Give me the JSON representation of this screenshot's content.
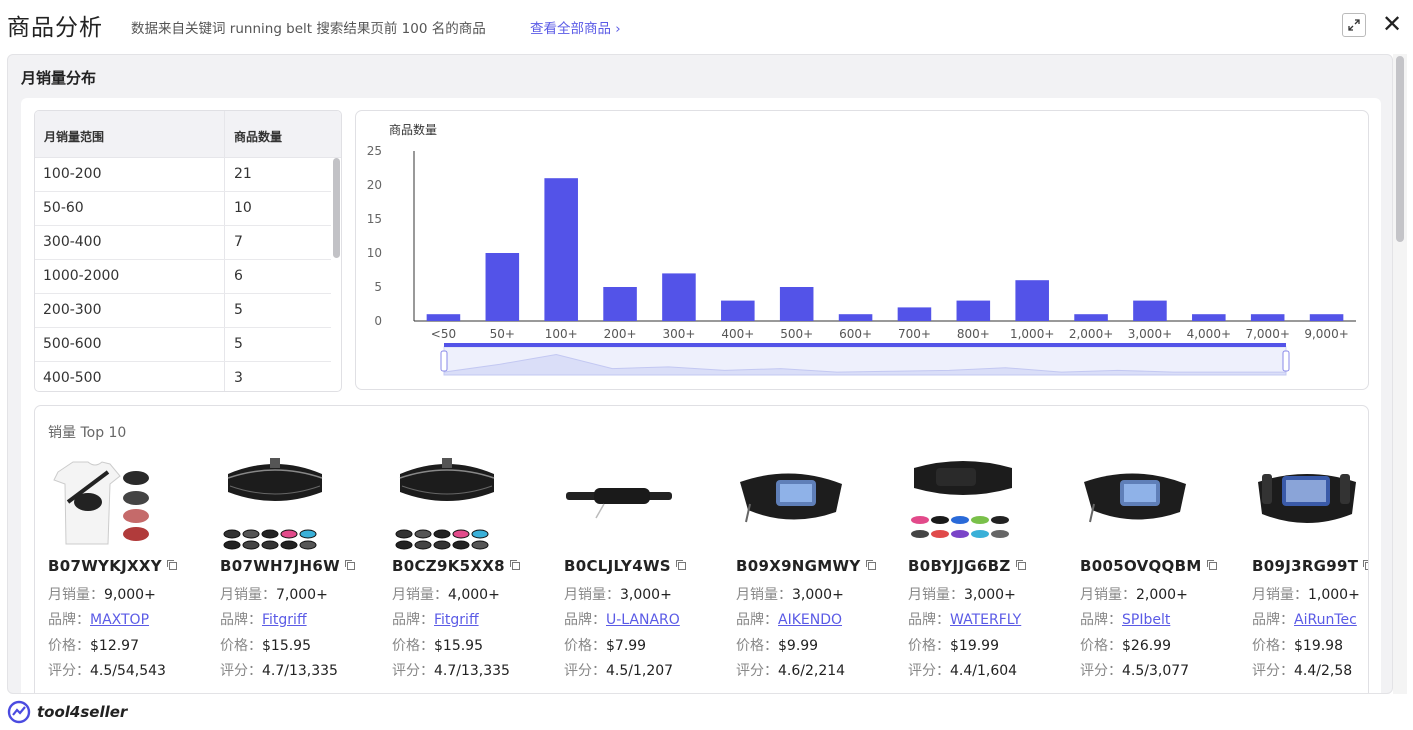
{
  "header": {
    "title": "商品分析",
    "subtitle": "数据来自关键词 running belt 搜索结果页前 100 名的商品",
    "view_all": "查看全部商品 ›",
    "expand_icon": "expand-icon",
    "close_icon": "close-icon",
    "close_glyph": "✕"
  },
  "section": {
    "title": "月销量分布"
  },
  "table": {
    "columns": [
      "月销量范围",
      "商品数量"
    ],
    "rows": [
      [
        "100-200",
        "21"
      ],
      [
        "50-60",
        "10"
      ],
      [
        "300-400",
        "7"
      ],
      [
        "1000-2000",
        "6"
      ],
      [
        "200-300",
        "5"
      ],
      [
        "500-600",
        "5"
      ],
      [
        "400-500",
        "3"
      ]
    ]
  },
  "chart_data": {
    "type": "bar",
    "ylabel": "商品数量",
    "categories": [
      "<50",
      "50+",
      "100+",
      "200+",
      "300+",
      "400+",
      "500+",
      "600+",
      "700+",
      "800+",
      "1,000+",
      "2,000+",
      "3,000+",
      "4,000+",
      "7,000+",
      "9,000+"
    ],
    "values": [
      1,
      10,
      21,
      5,
      7,
      3,
      5,
      1,
      2,
      3,
      6,
      1,
      3,
      1,
      1,
      1
    ],
    "ylim": [
      0,
      25
    ],
    "yticks": [
      0,
      5,
      10,
      15,
      20,
      25
    ],
    "bar_color": "#5353e8",
    "grid": false,
    "has_zoom_slider": true
  },
  "top10": {
    "title": "销量 Top 10",
    "labels": {
      "sales": "月销量：",
      "brand": "品牌：",
      "price": "价格：",
      "rating": "评分："
    },
    "items": [
      {
        "asin": "B07WYKJXXY",
        "sales": "9,000+",
        "brand": "MAXTOP",
        "price": "$12.97",
        "rating": "4.5/54,543",
        "image": "tshirt-waist-pack"
      },
      {
        "asin": "B07WH7JH6W",
        "sales": "7,000+",
        "brand": "Fitgriff",
        "price": "$15.95",
        "rating": "4.7/13,335",
        "image": "black-running-belt"
      },
      {
        "asin": "B0CZ9K5XX8",
        "sales": "4,000+",
        "brand": "Fitgriff",
        "price": "$15.95",
        "rating": "4.7/13,335",
        "image": "black-running-belt"
      },
      {
        "asin": "B0CLJLY4WS",
        "sales": "3,000+",
        "brand": "U-LANARO",
        "price": "$7.99",
        "rating": "4.5/1,207",
        "image": "slim-belt"
      },
      {
        "asin": "B09X9NGMWY",
        "sales": "3,000+",
        "brand": "AIKENDO",
        "price": "$9.99",
        "rating": "4.6/2,214",
        "image": "phone-belt"
      },
      {
        "asin": "B0BYJJG6BZ",
        "sales": "3,000+",
        "brand": "WATERFLY",
        "price": "$19.99",
        "rating": "4.4/1,604",
        "image": "color-belt"
      },
      {
        "asin": "B005OVQQBM",
        "sales": "2,000+",
        "brand": "SPIbelt",
        "price": "$26.99",
        "rating": "4.5/3,077",
        "image": "phone-belt"
      },
      {
        "asin": "B09J3RG99T",
        "sales": "1,000+",
        "brand": "AiRunTec",
        "price": "$19.98",
        "rating": "4.4/2,58",
        "image": "hydration-belt"
      }
    ]
  },
  "footer": {
    "brand": "tool4seller",
    "logo_icon": "tool4seller-logo-icon"
  },
  "colors": {
    "accent": "#5b5be6",
    "bar": "#5353e8"
  }
}
